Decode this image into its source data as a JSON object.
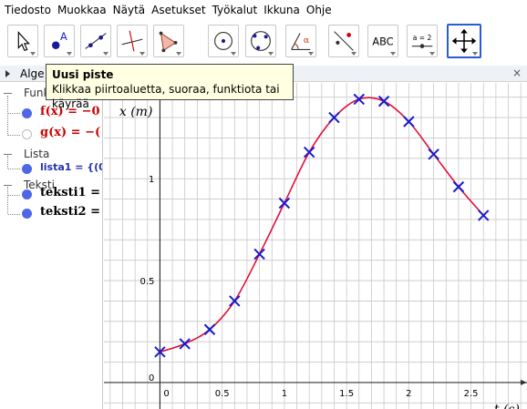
{
  "menu": [
    "Tiedosto",
    "Muokkaa",
    "Näytä",
    "Asetukset",
    "Työkalut",
    "Ikkuna",
    "Ohje"
  ],
  "toolbar": {
    "tools": [
      {
        "name": "move-tool",
        "icon": "cursor-arrow-icon"
      },
      {
        "name": "new-point-tool",
        "icon": "point-icon",
        "label": "A"
      },
      {
        "name": "line-tool",
        "icon": "line-through-points-icon"
      },
      {
        "name": "perpendicular-tool",
        "icon": "perpendicular-line-icon"
      },
      {
        "name": "polygon-tool",
        "icon": "polygon-icon"
      },
      {
        "name": "circle-tool",
        "icon": "circle-center-point-icon"
      },
      {
        "name": "circle-three-points-tool",
        "icon": "circle-three-points-icon"
      },
      {
        "name": "angle-tool",
        "icon": "angle-icon",
        "label": "α"
      },
      {
        "name": "reflect-tool",
        "icon": "reflect-icon"
      },
      {
        "name": "text-tool",
        "icon": "text-icon",
        "label": "ABC"
      },
      {
        "name": "slider-tool",
        "icon": "slider-icon",
        "label": "a = 2"
      },
      {
        "name": "move-graphics-tool",
        "icon": "move-view-icon"
      }
    ],
    "selected": "move-graphics-tool"
  },
  "tooltip": {
    "title": "Uusi piste",
    "body": "Klikkaa piirtoaluetta, suoraa, funktiota tai käyrää"
  },
  "algebra": {
    "header": "Alge",
    "categories": {
      "functions": "Funk",
      "list": "Lista",
      "text": "Teksti"
    },
    "items": {
      "f": "f(x) = −0",
      "g": "g(x) = −(",
      "lista1": "lista1 = {(0,",
      "teksti1": "teksti1 =",
      "teksti2": "teksti2 ="
    }
  },
  "graphics": {
    "close": "×"
  },
  "chart_data": {
    "type": "scatter",
    "xlabel": "t (s)",
    "ylabel": "x (m)",
    "xlim": [
      -0.45,
      2.95
    ],
    "ylim": [
      -0.13,
      1.47
    ],
    "x_ticks": [
      "0",
      "0.5",
      "1",
      "1.5",
      "2",
      "2.5"
    ],
    "y_ticks": [
      "0",
      "0.5",
      "1"
    ],
    "grid": true,
    "points": [
      {
        "x": 0.0,
        "y": 0.15
      },
      {
        "x": 0.2,
        "y": 0.19
      },
      {
        "x": 0.4,
        "y": 0.26
      },
      {
        "x": 0.6,
        "y": 0.4
      },
      {
        "x": 0.8,
        "y": 0.63
      },
      {
        "x": 1.0,
        "y": 0.88
      },
      {
        "x": 1.2,
        "y": 1.13
      },
      {
        "x": 1.4,
        "y": 1.3
      },
      {
        "x": 1.6,
        "y": 1.39
      },
      {
        "x": 1.8,
        "y": 1.38
      },
      {
        "x": 2.0,
        "y": 1.28
      },
      {
        "x": 2.2,
        "y": 1.12
      },
      {
        "x": 2.4,
        "y": 0.96
      },
      {
        "x": 2.6,
        "y": 0.82
      }
    ],
    "colors": {
      "points": "#1a1acc",
      "curve": "#e0103a",
      "grid": "#c8c8c8",
      "axis": "#333333"
    }
  }
}
